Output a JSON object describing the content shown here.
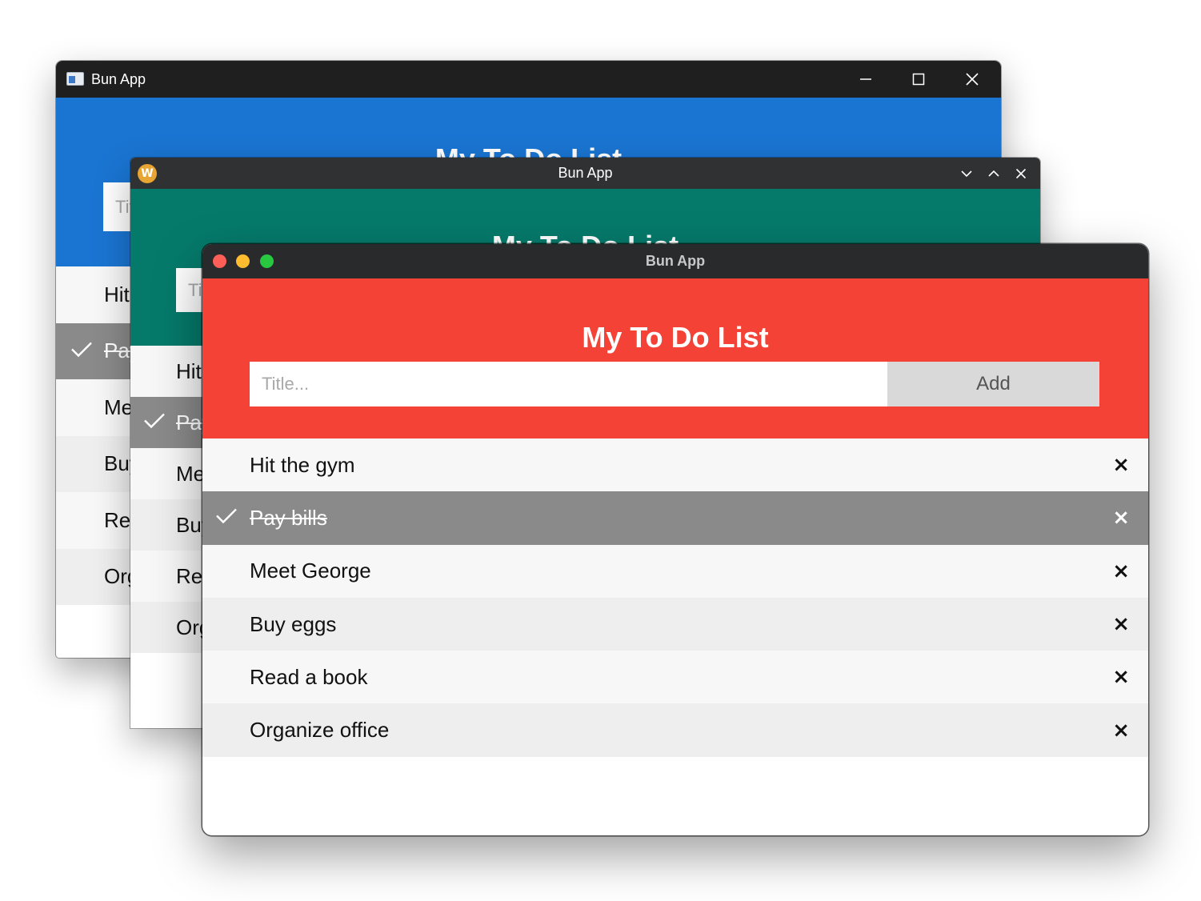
{
  "todo": {
    "heading": "My To Do List",
    "placeholder": "Title...",
    "add_label": "Add",
    "remove_glyph": "×",
    "items": [
      {
        "label": "Hit the gym",
        "checked": false
      },
      {
        "label": "Pay bills",
        "checked": true
      },
      {
        "label": "Meet George",
        "checked": false
      },
      {
        "label": "Buy eggs",
        "checked": false
      },
      {
        "label": "Read a book",
        "checked": false
      },
      {
        "label": "Organize office",
        "checked": false
      }
    ]
  },
  "windows": {
    "windows_style": {
      "title": "Bun App",
      "accent": "#1a75d2",
      "titlebar_color": "#1f1f1f"
    },
    "gnome_style": {
      "title": "Bun App",
      "accent": "#057a6b",
      "titlebar_color": "#2f3133",
      "icon_letter": "W"
    },
    "mac_style": {
      "title": "Bun App",
      "accent": "#f44236",
      "titlebar_color": "#292a2c",
      "traffic_lights": [
        "#ff5f57",
        "#febc2e",
        "#28c840"
      ]
    }
  }
}
